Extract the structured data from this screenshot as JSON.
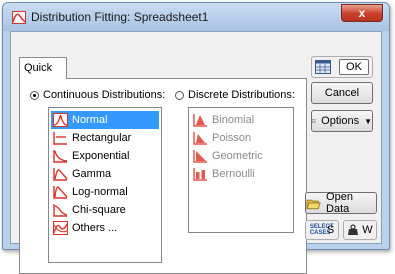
{
  "window": {
    "title": "Distribution Fitting: Spreadsheet1",
    "close_label": "x"
  },
  "tab": {
    "label": "Quick"
  },
  "continuous": {
    "label": "Continuous Distributions:",
    "selected": true,
    "items": [
      {
        "label": "Normal",
        "icon": "normal-curve-icon"
      },
      {
        "label": "Rectangular",
        "icon": "rectangular-icon"
      },
      {
        "label": "Exponential",
        "icon": "exponential-curve-icon"
      },
      {
        "label": "Gamma",
        "icon": "gamma-curve-icon"
      },
      {
        "label": "Log-normal",
        "icon": "log-normal-curve-icon"
      },
      {
        "label": "Chi-square",
        "icon": "chi-square-curve-icon"
      },
      {
        "label": "Others ...",
        "icon": "others-distribution-icon"
      }
    ],
    "selected_item": "Normal"
  },
  "discrete": {
    "label": "Discrete Distributions:",
    "selected": false,
    "items": [
      {
        "label": "Binomial",
        "icon": "binomial-bars-icon"
      },
      {
        "label": "Poisson",
        "icon": "poisson-bars-icon"
      },
      {
        "label": "Geometric",
        "icon": "geometric-bars-icon"
      },
      {
        "label": "Bernoulli",
        "icon": "bernoulli-bars-icon"
      }
    ]
  },
  "buttons": {
    "ok": "OK",
    "cancel": "Cancel",
    "options": "Options",
    "open_data": "Open Data",
    "select_cases_letter": "S",
    "weight_letter": "W",
    "select_cases_icon_text": "SELECT CASES"
  },
  "colors": {
    "accent_selection": "#3399ff",
    "icon_red": "#d9342b",
    "title_bar": "#b9d1ea"
  }
}
